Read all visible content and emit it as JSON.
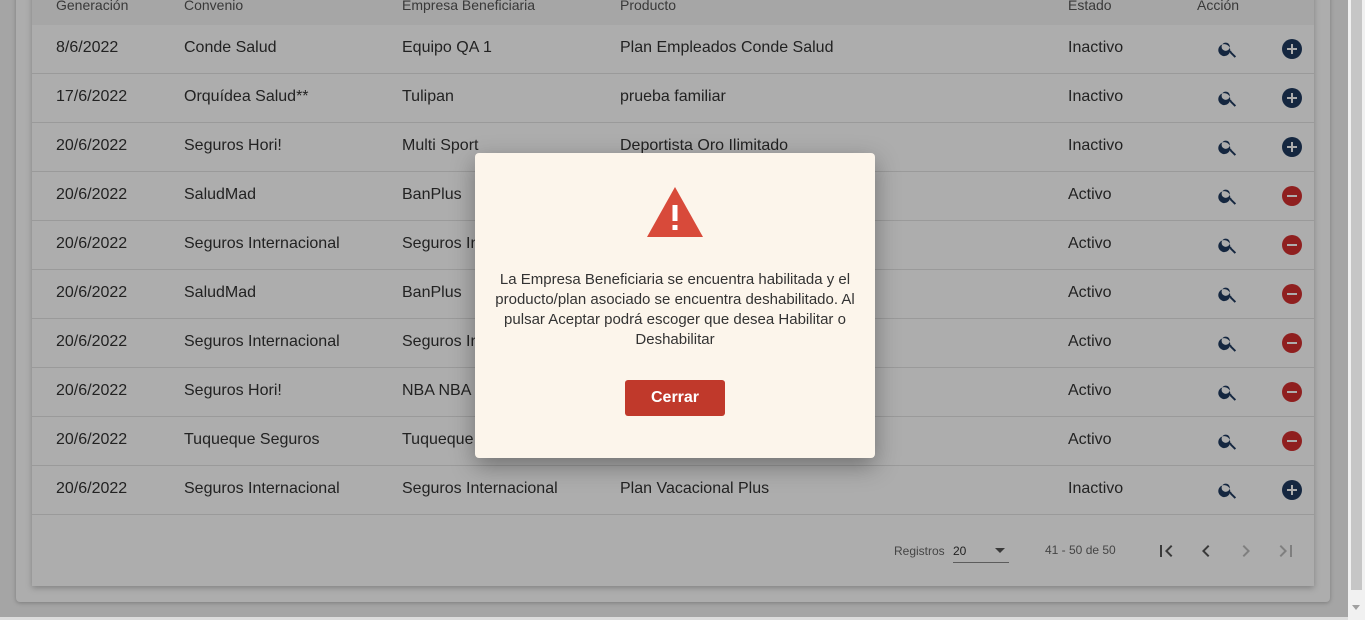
{
  "table": {
    "headers": [
      "Generación",
      "Convenio",
      "Empresa Beneficiaria",
      "Producto",
      "Estado",
      "Acción"
    ],
    "rows": [
      {
        "fecha": "8/6/2022",
        "convenio": "Conde Salud",
        "empresa": "Equipo QA 1",
        "producto": "Plan Empleados Conde Salud",
        "estado": "Inactivo",
        "action": "add"
      },
      {
        "fecha": "17/6/2022",
        "convenio": "Orquídea Salud**",
        "empresa": "Tulipan",
        "producto": "prueba familiar",
        "estado": "Inactivo",
        "action": "add"
      },
      {
        "fecha": "20/6/2022",
        "convenio": "Seguros Hori!",
        "empresa": "Multi Sport",
        "producto": "Deportista Oro Ilimitado",
        "estado": "Inactivo",
        "action": "add"
      },
      {
        "fecha": "20/6/2022",
        "convenio": "SaludMad",
        "empresa": "BanPlus",
        "producto": "",
        "estado": "Activo",
        "action": "remove"
      },
      {
        "fecha": "20/6/2022",
        "convenio": "Seguros Internacional",
        "empresa": "Seguros In",
        "producto": "",
        "estado": "Activo",
        "action": "remove"
      },
      {
        "fecha": "20/6/2022",
        "convenio": "SaludMad",
        "empresa": "BanPlus",
        "producto": "",
        "estado": "Activo",
        "action": "remove"
      },
      {
        "fecha": "20/6/2022",
        "convenio": "Seguros Internacional",
        "empresa": "Seguros In",
        "producto": "",
        "estado": "Activo",
        "action": "remove"
      },
      {
        "fecha": "20/6/2022",
        "convenio": "Seguros Hori!",
        "empresa": "NBA NBA",
        "producto": "",
        "estado": "Activo",
        "action": "remove"
      },
      {
        "fecha": "20/6/2022",
        "convenio": "Tuqueque Seguros",
        "empresa": "Tuqueque",
        "producto": "",
        "estado": "Activo",
        "action": "remove"
      },
      {
        "fecha": "20/6/2022",
        "convenio": "Seguros Internacional",
        "empresa": "Seguros Internacional",
        "producto": "Plan Vacacional Plus",
        "estado": "Inactivo",
        "action": "add"
      }
    ]
  },
  "paginator": {
    "label": "Registros",
    "page_size": "20",
    "range": "41 - 50 de 50"
  },
  "dialog": {
    "message": "La Empresa Beneficiaria se encuentra habilitada y el producto/plan asociado se encuentra deshabilitado. Al pulsar Aceptar podrá escoger que desea Habilitar o Deshabilitar",
    "close_label": "Cerrar"
  },
  "colors": {
    "add": "#1f3a5f",
    "remove": "#d32f2f",
    "warning": "#d84a3a",
    "dialog_button": "#c0392b",
    "dialog_bg": "#fcf5eb"
  },
  "icons": {
    "search": "search-icon",
    "add": "plus-circle-icon",
    "remove": "minus-circle-icon",
    "warning": "warning-triangle-icon",
    "first": "first-page-icon",
    "prev": "chevron-left-icon",
    "next": "chevron-right-icon",
    "last": "last-page-icon"
  }
}
